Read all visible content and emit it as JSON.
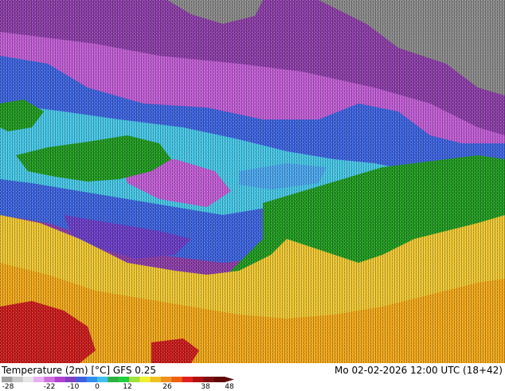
{
  "map": {
    "colors": {
      "cold_deep": "#2a0a5a",
      "purple": "#8c3ca8",
      "magenta": "#c25cd6",
      "violet": "#6a3cc8",
      "blue": "#3b63e0",
      "light_blue": "#4aa6ee",
      "cyan": "#45c8e8",
      "green": "#1f9a1f",
      "bright_green": "#2fbf2f",
      "yellow": "#f0c830",
      "orange": "#f2a818",
      "dark_orange": "#e88410",
      "red": "#cc1a1a",
      "dark_red": "#8e0a0a",
      "gray": "#8a8a8a"
    }
  },
  "footer": {
    "title": "Temperature (2m) [°C] GFS 0.25",
    "datetime": "Mo 02-02-2026 12:00 UTC (18+42)",
    "colorbar": {
      "ticks": [
        "-28",
        "-22",
        "-10",
        "0",
        "12",
        "26",
        "38",
        "48"
      ],
      "stops": [
        "#a0a0a0",
        "#c8c8c8",
        "#e6e6e6",
        "#e8b0f0",
        "#d070e0",
        "#b040d0",
        "#8040c0",
        "#4060e0",
        "#3090f0",
        "#40c0f0",
        "#30b040",
        "#20d040",
        "#a0e040",
        "#f0f030",
        "#f0c020",
        "#f09020",
        "#f06010",
        "#e02020",
        "#b01010",
        "#801010",
        "#600808"
      ]
    }
  }
}
